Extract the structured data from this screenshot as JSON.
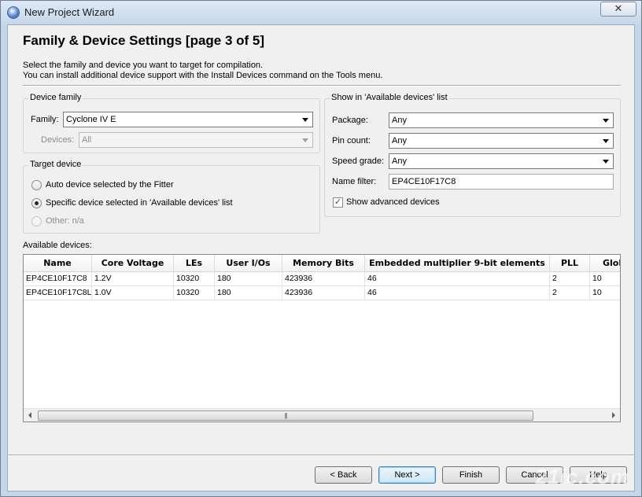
{
  "window": {
    "title": "New Project Wizard",
    "close_label": "✕"
  },
  "header": {
    "title": "Family & Device Settings [page 3 of 5]",
    "description_line1": "Select the family and device you want to target for compilation.",
    "description_line2": "You can install additional device support with the Install Devices command on the Tools menu."
  },
  "device_family": {
    "group_label": "Device family",
    "family_label": "Family:",
    "family_value": "Cyclone IV E",
    "devices_label": "Devices:",
    "devices_value": "All"
  },
  "target_device": {
    "group_label": "Target device",
    "options": [
      {
        "label": "Auto device selected by the Fitter",
        "checked": false,
        "enabled": true
      },
      {
        "label": "Specific device selected in 'Available devices' list",
        "checked": true,
        "enabled": true
      },
      {
        "label": "Other:  n/a",
        "checked": false,
        "enabled": false
      }
    ]
  },
  "show_in_list": {
    "group_label": "Show in 'Available devices' list",
    "package_label": "Package:",
    "package_value": "Any",
    "pin_count_label": "Pin count:",
    "pin_count_value": "Any",
    "speed_grade_label": "Speed grade:",
    "speed_grade_value": "Any",
    "name_filter_label": "Name filter:",
    "name_filter_value": "EP4CE10F17C8",
    "show_advanced_label": "Show advanced devices",
    "show_advanced_checked": true
  },
  "available_devices": {
    "label": "Available devices:",
    "columns": [
      "Name",
      "Core Voltage",
      "LEs",
      "User I/Os",
      "Memory Bits",
      "Embedded multiplier 9-bit elements",
      "PLL",
      "Glob"
    ],
    "rows": [
      [
        "EP4CE10F17C8",
        "1.2V",
        "10320",
        "180",
        "423936",
        "46",
        "2",
        "10"
      ],
      [
        "EP4CE10F17C8L",
        "1.0V",
        "10320",
        "180",
        "423936",
        "46",
        "2",
        "10"
      ]
    ],
    "scroll_thumb_grip": "|||"
  },
  "buttons": {
    "back": "< Back",
    "next": "Next >",
    "finish": "Finish",
    "cancel": "Cancel",
    "help": "Help"
  },
  "watermark": "21ic.com"
}
